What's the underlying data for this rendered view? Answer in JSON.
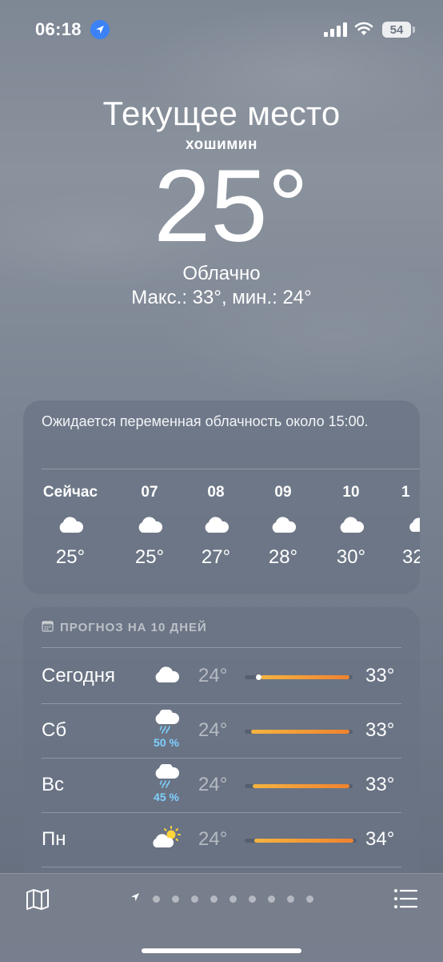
{
  "status_bar": {
    "time": "06:18",
    "battery": "54",
    "location_icon": "location-arrow-icon",
    "signal_icon": "cellular-signal-icon",
    "wifi_icon": "wifi-icon"
  },
  "header": {
    "place": "Текущее место",
    "city": "хошимин",
    "temperature": "25°",
    "condition": "Облачно",
    "high_low": "Макс.: 33°, мин.: 24°"
  },
  "hourly": {
    "summary": "Ожидается переменная облачность около 15:00.",
    "hours": [
      {
        "label": "Сейчас",
        "icon": "cloud-icon",
        "temp": "25°"
      },
      {
        "label": "07",
        "icon": "cloud-icon",
        "temp": "25°"
      },
      {
        "label": "08",
        "icon": "cloud-icon",
        "temp": "27°"
      },
      {
        "label": "09",
        "icon": "cloud-icon",
        "temp": "28°"
      },
      {
        "label": "10",
        "icon": "cloud-icon",
        "temp": "30°"
      },
      {
        "label": "1",
        "icon": "cloud-icon",
        "temp": "32"
      }
    ]
  },
  "daily": {
    "title": "ПРОГНОЗ НА 10 ДНЕЙ",
    "title_icon": "calendar-icon",
    "days": [
      {
        "day": "Сегодня",
        "icon": "cloud-icon",
        "precip": "",
        "low": "24°",
        "high": "33°"
      },
      {
        "day": "Сб",
        "icon": "cloud-rain-icon",
        "precip": "50 %",
        "low": "24°",
        "high": "33°"
      },
      {
        "day": "Вс",
        "icon": "cloud-rain-icon",
        "precip": "45 %",
        "low": "24°",
        "high": "33°"
      },
      {
        "day": "Пн",
        "icon": "partly-sunny-icon",
        "precip": "",
        "low": "24°",
        "high": "34°"
      }
    ]
  },
  "bottom_bar": {
    "map_icon": "map-icon",
    "list_icon": "list-icon",
    "page_count": 9,
    "current_location_icon": "location-arrow-icon"
  },
  "colors": {
    "accent_blue": "#3b82f6",
    "precip_text": "#7fd0ff",
    "range_start": "#f5b43f",
    "range_end": "#f0822f"
  }
}
